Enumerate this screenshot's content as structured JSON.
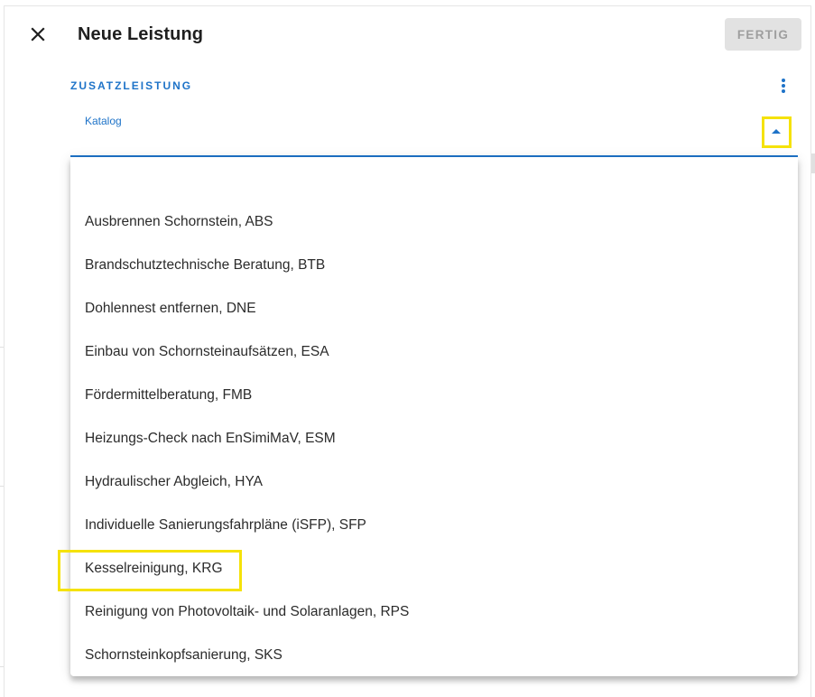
{
  "header": {
    "title": "Neue Leistung",
    "done_label": "FERTIG"
  },
  "section": {
    "title": "ZUSATZLEISTUNG"
  },
  "select": {
    "label": "Katalog",
    "value": ""
  },
  "dropdown": {
    "options": [
      "",
      "Ausbrennen Schornstein, ABS",
      "Brandschutztechnische Beratung, BTB",
      "Dohlennest entfernen, DNE",
      "Einbau von Schornsteinaufsätzen, ESA",
      "Fördermittelberatung, FMB",
      "Heizungs-Check nach EnSimiMaV, ESM",
      "Hydraulischer Abgleich, HYA",
      "Individuelle Sanierungsfahrpläne (iSFP), SFP",
      "Kesselreinigung, KRG",
      "Reinigung von Photovoltaik- und Solaranlagen, RPS",
      "Schornsteinkopfsanierung, SKS"
    ]
  },
  "icons": {
    "close": "close-icon",
    "more": "more-vert-icon",
    "caret": "caret-up-icon"
  },
  "colors": {
    "accent": "#1e73c8",
    "highlight": "#f5e20a",
    "disabled_button_bg": "#e2e2e2",
    "disabled_button_text": "#9e9e9e"
  }
}
